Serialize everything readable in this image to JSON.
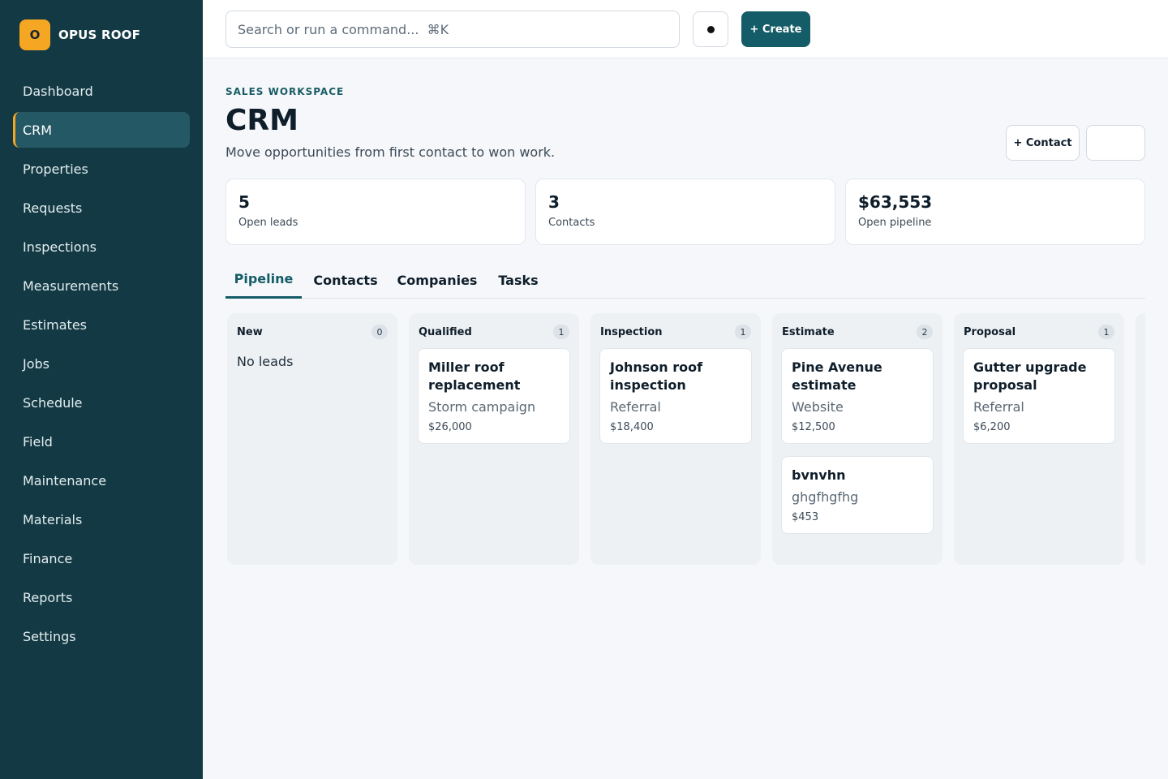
{
  "brand": {
    "logo_letter": "O",
    "name": "OPUS ROOF"
  },
  "nav": [
    {
      "label": "Dashboard",
      "active": false
    },
    {
      "label": "CRM",
      "active": true
    },
    {
      "label": "Properties",
      "active": false
    },
    {
      "label": "Requests",
      "active": false
    },
    {
      "label": "Inspections",
      "active": false
    },
    {
      "label": "Measurements",
      "active": false
    },
    {
      "label": "Estimates",
      "active": false
    },
    {
      "label": "Jobs",
      "active": false
    },
    {
      "label": "Schedule",
      "active": false
    },
    {
      "label": "Field",
      "active": false
    },
    {
      "label": "Maintenance",
      "active": false
    },
    {
      "label": "Materials",
      "active": false
    },
    {
      "label": "Finance",
      "active": false
    },
    {
      "label": "Reports",
      "active": false
    },
    {
      "label": "Settings",
      "active": false
    }
  ],
  "topbar": {
    "search_placeholder": "Search or run a command...  ⌘K",
    "create_label": "+ Create"
  },
  "header": {
    "eyebrow": "SALES WORKSPACE",
    "title": "CRM",
    "subtitle": "Move opportunities from first contact to won work.",
    "contact_button": "+ Contact"
  },
  "stats": [
    {
      "value": "5",
      "label": "Open leads"
    },
    {
      "value": "3",
      "label": "Contacts"
    },
    {
      "value": "$63,553",
      "label": "Open pipeline"
    }
  ],
  "tabs": [
    {
      "label": "Pipeline",
      "active": true
    },
    {
      "label": "Contacts",
      "active": false
    },
    {
      "label": "Companies",
      "active": false
    },
    {
      "label": "Tasks",
      "active": false
    }
  ],
  "columns": [
    {
      "name": "New",
      "count": "0",
      "empty_text": "No leads",
      "cards": []
    },
    {
      "name": "Qualified",
      "count": "1",
      "cards": [
        {
          "title": "Miller roof replacement",
          "source": "Storm campaign",
          "value": "$26,000"
        }
      ]
    },
    {
      "name": "Inspection",
      "count": "1",
      "cards": [
        {
          "title": "Johnson roof inspection",
          "source": "Referral",
          "value": "$18,400"
        }
      ]
    },
    {
      "name": "Estimate",
      "count": "2",
      "cards": [
        {
          "title": "Pine Avenue estimate",
          "source": "Website",
          "value": "$12,500"
        },
        {
          "title": "bvnvhn",
          "source": "ghgfhgfhg",
          "value": "$453"
        }
      ]
    },
    {
      "name": "Proposal",
      "count": "1",
      "cards": [
        {
          "title": "Gutter upgrade proposal",
          "source": "Referral",
          "value": "$6,200"
        }
      ]
    }
  ]
}
